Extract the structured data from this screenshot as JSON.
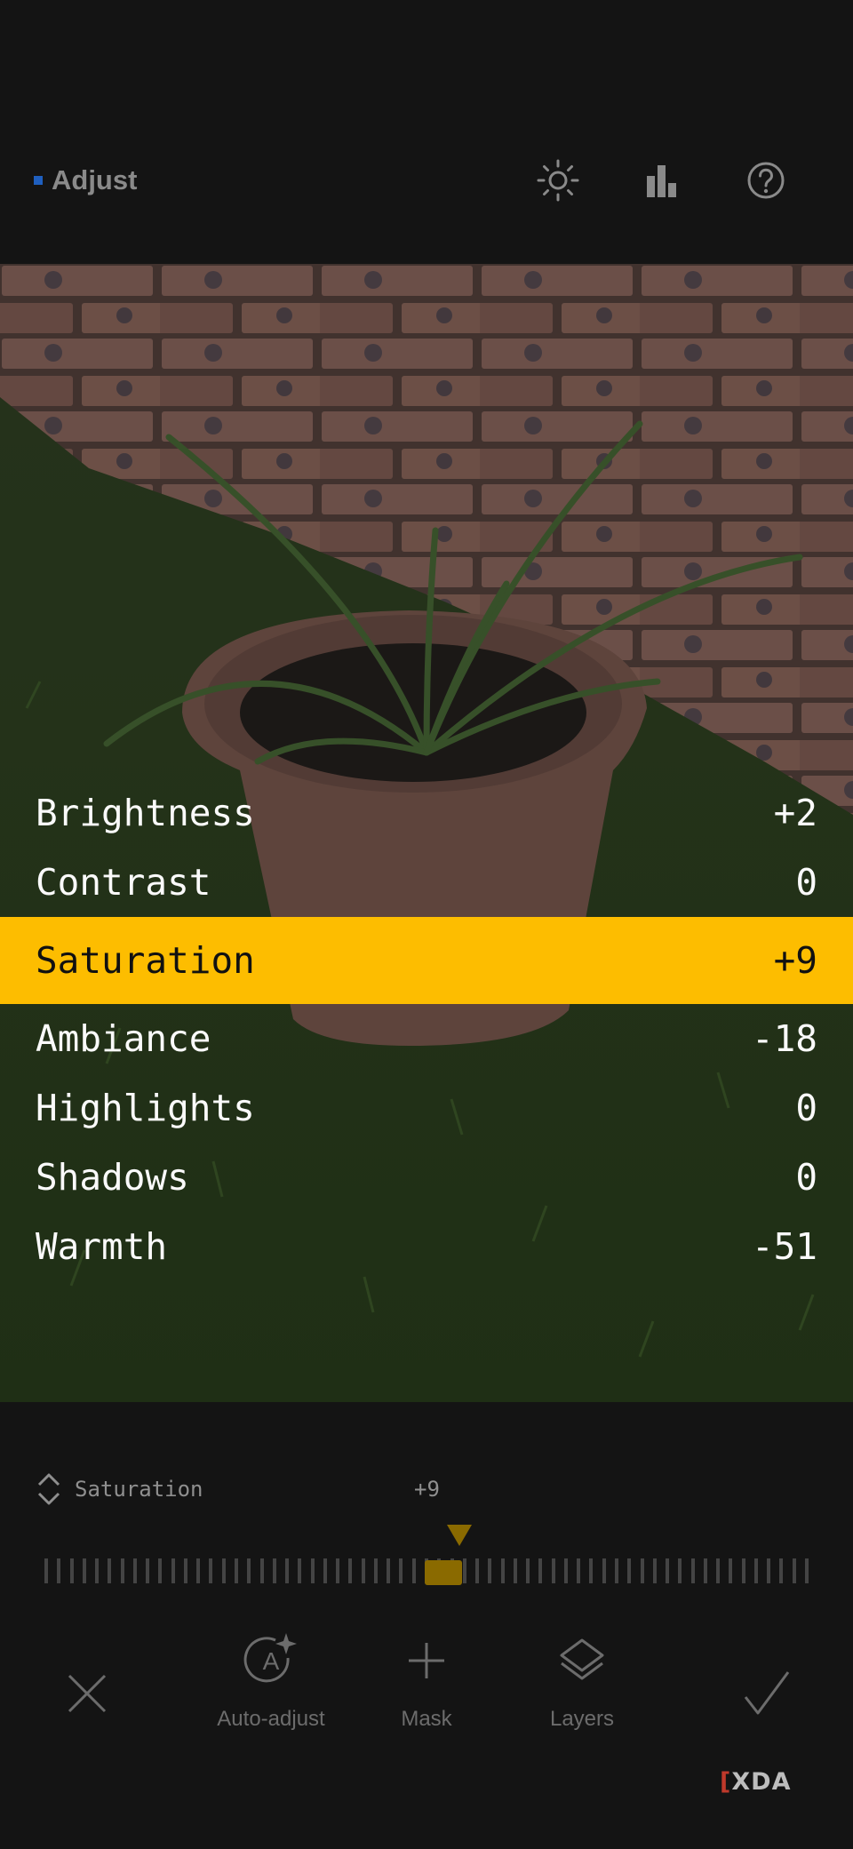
{
  "header": {
    "title": "Adjust",
    "icons": [
      "brightness-icon",
      "histogram-icon",
      "help-icon"
    ]
  },
  "adjustments": [
    {
      "label": "Brightness",
      "value": "+2"
    },
    {
      "label": "Contrast",
      "value": "0"
    },
    {
      "label": "Saturation",
      "value": "+9",
      "selected": true
    },
    {
      "label": "Ambiance",
      "value": "-18"
    },
    {
      "label": "Highlights",
      "value": "0"
    },
    {
      "label": "Shadows",
      "value": "0"
    },
    {
      "label": "Warmth",
      "value": "-51"
    }
  ],
  "slider": {
    "parameter": "Saturation",
    "value": "+9",
    "fraction": 0.545
  },
  "toolbar": {
    "cancel_icon": "close-icon",
    "auto_adjust_label": "Auto-adjust",
    "mask_label": "Mask",
    "layers_label": "Layers",
    "confirm_icon": "check-icon"
  },
  "watermark": "XDA",
  "colors": {
    "accent": "#fdbd00",
    "slider_marker": "#8a6a00",
    "background": "#141414"
  }
}
